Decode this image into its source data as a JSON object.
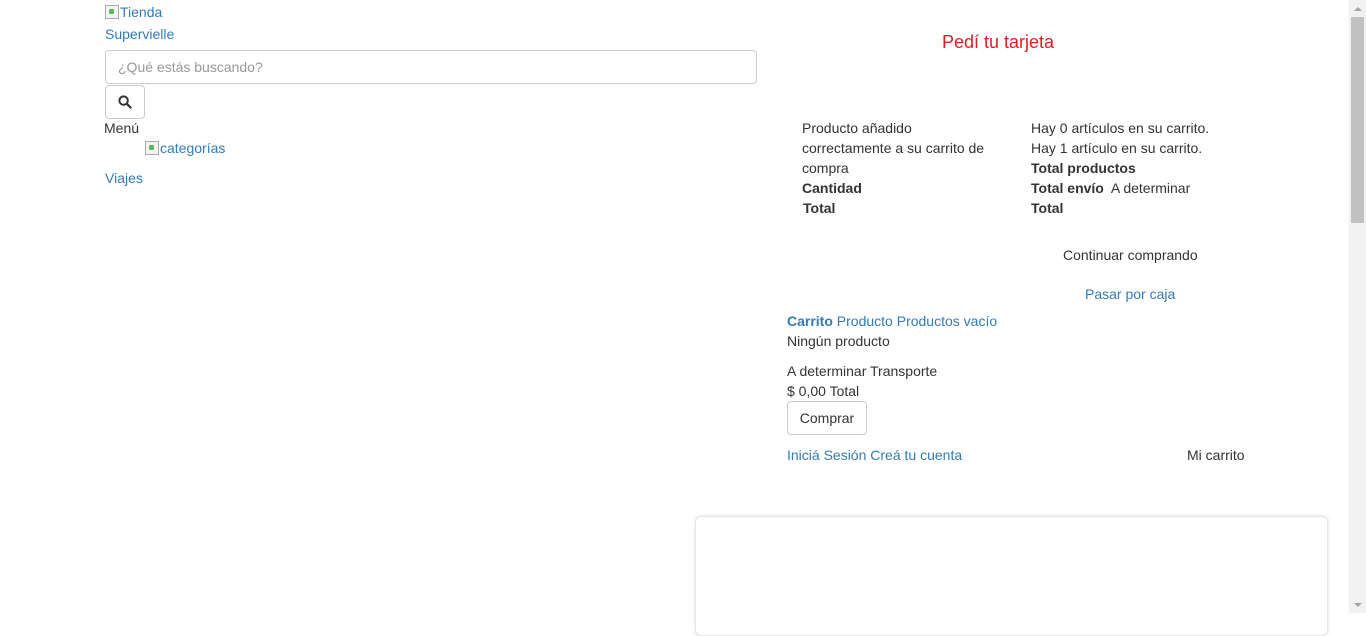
{
  "header": {
    "logo_alt_line1": "Tienda",
    "logo_alt_line2": "Supervielle",
    "search_placeholder": "¿Qué estás buscando?",
    "search_icon": "search-icon",
    "card_cta": "Pedí tu tarjeta"
  },
  "nav": {
    "menu_label": "Menú",
    "categories_alt": "categorías",
    "items": [
      {
        "label": "Viajes"
      }
    ]
  },
  "cart_modal": {
    "added_message": "Producto añadido correctamente a su carrito de compra",
    "quantity_label": "Cantidad",
    "total_label": "Total",
    "items_zero": "Hay 0 artículos en su carrito.",
    "items_one": "Hay 1 artículo en su carrito.",
    "total_products_label": "Total productos",
    "total_shipping_label": "Total envío",
    "shipping_value": "A determinar",
    "summary_total_label": "Total",
    "continue_label": "Continuar comprando",
    "checkout_label": "Pasar por caja"
  },
  "cart_block": {
    "cart_label": "Carrito",
    "product_label": "Producto",
    "products_label": "Productos",
    "empty_label": "vacío",
    "no_product": "Ningún producto",
    "shipping_value": "A determinar",
    "shipping_label": "Transporte",
    "total_value": "$ 0,00",
    "total_label": "Total",
    "buy_button": "Comprar"
  },
  "account": {
    "login_label": "Iniciá Sesión",
    "register_label": "Creá tu cuenta",
    "my_cart_label": "Mi carrito"
  },
  "colors": {
    "accent_red": "#e21c23",
    "link_blue": "#337ab7"
  }
}
